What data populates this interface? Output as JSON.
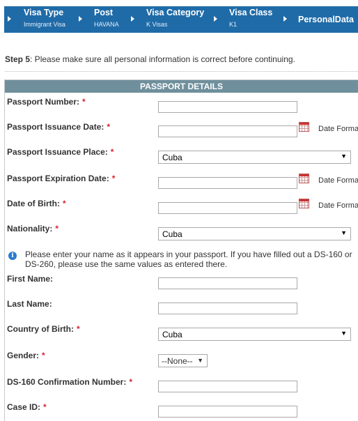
{
  "breadcrumbs": [
    {
      "title": "Visa Type",
      "sub": "Immigrant Visa"
    },
    {
      "title": "Post",
      "sub": "HAVANA"
    },
    {
      "title": "Visa Category",
      "sub": "K Visas"
    },
    {
      "title": "Visa Class",
      "sub": "K1"
    },
    {
      "title": "PersonalData",
      "sub": ""
    }
  ],
  "step": {
    "prefix": "Step 5",
    "text": ": Please make sure all personal information is correct before continuing."
  },
  "section_title": "PASSPORT DETAILS",
  "required_mark": "*",
  "date_format_label": "Date Format",
  "fields": {
    "passport_number": {
      "label": "Passport Number:",
      "value": ""
    },
    "issuance_date": {
      "label": "Passport Issuance Date:",
      "value": ""
    },
    "issuance_place": {
      "label": "Passport Issuance Place:",
      "value": "Cuba"
    },
    "expiration_date": {
      "label": "Passport Expiration Date:",
      "value": ""
    },
    "date_of_birth": {
      "label": "Date of Birth:",
      "value": ""
    },
    "nationality": {
      "label": "Nationality:",
      "value": "Cuba"
    },
    "first_name": {
      "label": "First Name:",
      "value": ""
    },
    "last_name": {
      "label": "Last Name:",
      "value": ""
    },
    "country_of_birth": {
      "label": "Country of Birth:",
      "value": "Cuba"
    },
    "gender": {
      "label": "Gender:",
      "value": "--None--"
    },
    "ds160": {
      "label": "DS-160 Confirmation Number:",
      "value": ""
    },
    "case_id": {
      "label": "Case ID:",
      "value": ""
    }
  },
  "info_note": "Please enter your name as it appears in your passport. If you have filled out a DS-160 or DS-260, please use the same values as entered there.",
  "icons": {
    "calendar": "calendar-icon",
    "info": "info-icon",
    "dropdown": "chevron-down-icon"
  },
  "colors": {
    "breadcrumb_bg": "#1f6ba8",
    "section_header_bg": "#6f8f9c",
    "required": "#d9232d",
    "info": "#2a7ad0"
  }
}
